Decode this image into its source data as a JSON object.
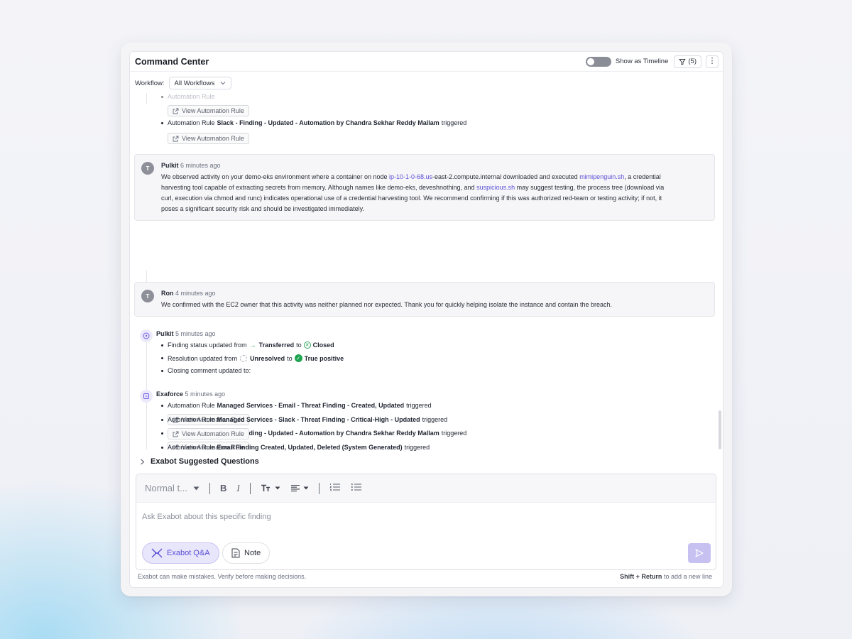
{
  "header": {
    "title": "Command Center",
    "timeline_label": "Show as Timeline",
    "filter_count": "(5)",
    "more_glyph": "⋮"
  },
  "workflow": {
    "label": "Workflow:",
    "selected": "All Workflows"
  },
  "feed": {
    "top_partial": {
      "rule2_prefix": "Automation Rule",
      "rule2_name": "Slack - Finding - Updated - Automation by Chandra Sekhar Reddy Mallam",
      "rule2_suffix": "triggered",
      "view_label": "View Automation Rule"
    },
    "comment1": {
      "initial": "T",
      "author": "Pulkit",
      "time": "6 minutes ago",
      "line1_a": "We observed activity on your demo-eks environment where a container on node ",
      "line1_link1": "ip-10-1-0-68.us",
      "line1_b": "-east-2.compute.internal downloaded and executed ",
      "line1_link2": "mimipenguin.sh",
      "line1_c": ", a credential",
      "line2_a": "harvesting tool capable of extracting secrets from memory. Although names like demo-eks, deveshnothing, and ",
      "line2_link": "suspicious.sh",
      "line2_b": " may suggest testing, the process tree (download via",
      "line3": "curl, execution via chmod and runc) indicates operational use of a credential harvesting tool. We recommend confirming if this was authorized red-team or testing activity; if not, it",
      "line4": "poses a significant security risk and should be investigated immediately."
    },
    "comment2": {
      "initial": "T",
      "author": "Ron",
      "time": "4 minutes ago",
      "text": "We confirmed with the EC2 owner that this activity was neither planned nor expected. Thank you for quickly helping isolate the instance and contain the breach."
    },
    "status_event": {
      "author": "Pulkit",
      "time": "5 minutes ago",
      "status_prefix": "Finding status updated from",
      "status_from": "Transferred",
      "to": "to",
      "status_to": "Closed",
      "resolution_prefix": "Resolution updated from",
      "resolution_from": "Unresolved",
      "resolution_to": "True positive",
      "closing": "Closing comment updated to:"
    },
    "exaforce_event": {
      "author": "Exaforce",
      "time": "5 minutes ago",
      "prefix": "Automation Rule",
      "suffix": "triggered",
      "view_label": "View Automation Rule",
      "rules": [
        "Managed Services - Email - Threat Finding - Created, Updated",
        "Slack - Finding - Updated - Automation by Chandra Sekhar Reddy Mallam",
        "Managed Services - Slack - Threat Finding - Critical-High - Updated",
        "Email Finding Created, Updated, Deleted (System Generated)"
      ]
    }
  },
  "suggested": {
    "label": "Exabot Suggested Questions"
  },
  "composer": {
    "style_select": "Normal t...",
    "placeholder": "Ask Exabot about this specific finding",
    "qa_label": "Exabot Q&A",
    "note_label": "Note"
  },
  "footer": {
    "disclaimer": "Exabot can make mistakes. Verify before making decisions.",
    "shortcut_key": "Shift + Return",
    "shortcut_text": " to add a new line"
  },
  "colors": {
    "accent": "#5a4fd6",
    "success": "#1fa552"
  }
}
